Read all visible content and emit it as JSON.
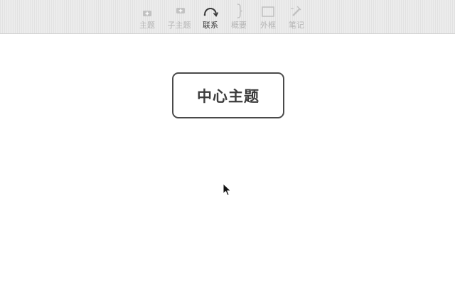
{
  "toolbar": {
    "tools": [
      {
        "label": "主题",
        "icon": "topic-icon",
        "active": false
      },
      {
        "label": "子主题",
        "icon": "subtopic-icon",
        "active": false
      },
      {
        "label": "联系",
        "icon": "relationship-icon",
        "active": true
      },
      {
        "label": "概要",
        "icon": "summary-brace-icon",
        "active": false
      },
      {
        "label": "外框",
        "icon": "boundary-icon",
        "active": false
      },
      {
        "label": "笔记",
        "icon": "notes-pencil-icon",
        "active": false
      }
    ]
  },
  "canvas": {
    "central_topic": "中心主题"
  },
  "colors": {
    "toolbar_bg": "#ececec",
    "disabled_label": "#b4b4b4",
    "active_label": "#3a3a3a",
    "topic_border": "#4a4a4a"
  }
}
